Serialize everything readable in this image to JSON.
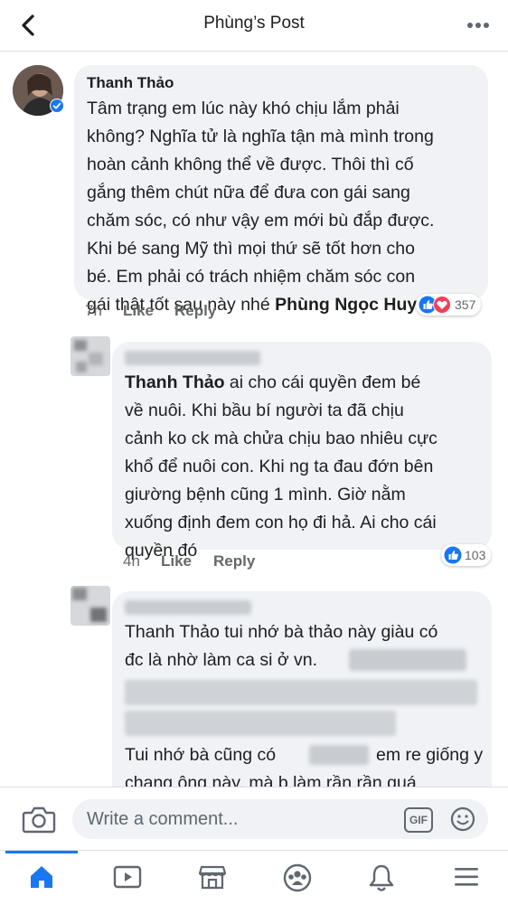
{
  "header": {
    "title": "Phùng’s Post",
    "back_icon": "back-arrow-icon",
    "more_icon": "more-dots-icon"
  },
  "comments": [
    {
      "author": "Thanh Thảo",
      "verified": true,
      "text": "Tâm trạng em lúc này khó chịu lắm phải\nkhông? Nghĩa tử là nghĩa tận mà mình trong\nhoàn cảnh không thể về được. Thôi thì cố\ngắng thêm chút nữa để đưa con gái sang\nchăm sóc, có như vậy em mới bù đắp được.\nKhi bé sang Mỹ thì mọi thứ sẽ tốt hơn cho\nbé. Em phải có trách nhiệm chăm sóc con\ngái thật tốt sau này nhé ",
      "mention": "Phùng Ngọc Huy",
      "time": "7h",
      "like_label": "Like",
      "reply_label": "Reply",
      "reaction_count": "357",
      "reactions": [
        "like",
        "love"
      ]
    },
    {
      "mention": "Thanh Thảo",
      "text": " ai cho cái quyền đem bé\nvề nuôi. Khi bầu bí người ta đã chịu\ncảnh ko ck mà chửa chịu bao nhiêu cực\nkhổ để nuôi con. Khi ng ta đau đớn bên\ngiường bệnh cũng 1 mình. Giờ nằm\nxuống định đem con họ đi hả. Ai cho cái\nquyền đó",
      "time": "4h",
      "like_label": "Like",
      "reply_label": "Reply",
      "reaction_count": "103",
      "reactions": [
        "like"
      ]
    },
    {
      "line1": "Thanh Thảo tui nhớ bà thảo này giàu có",
      "line2": "đc là nhờ làm ca si ở vn.",
      "line3a": "Tui nhớ bà cũng có",
      "line3b": "em re giống y",
      "line4": "chang ông này. mà b làm rần rần quá"
    }
  ],
  "composer": {
    "placeholder": "Write a comment...",
    "gif_label": "GIF",
    "camera_icon": "camera-icon",
    "emoji_icon": "emoji-icon"
  },
  "tabbar": {
    "tabs": [
      {
        "name": "home",
        "icon": "home-icon",
        "active": true
      },
      {
        "name": "watch",
        "icon": "video-play-icon",
        "active": false
      },
      {
        "name": "marketplace",
        "icon": "marketplace-store-icon",
        "active": false
      },
      {
        "name": "groups",
        "icon": "groups-icon",
        "active": false
      },
      {
        "name": "notifications",
        "icon": "bell-icon",
        "active": false
      },
      {
        "name": "menu",
        "icon": "hamburger-menu-icon",
        "active": false
      }
    ]
  },
  "colors": {
    "accent": "#1877f2",
    "bubble": "#f0f2f5",
    "love": "#f33e58",
    "meta_text": "#65676b"
  }
}
